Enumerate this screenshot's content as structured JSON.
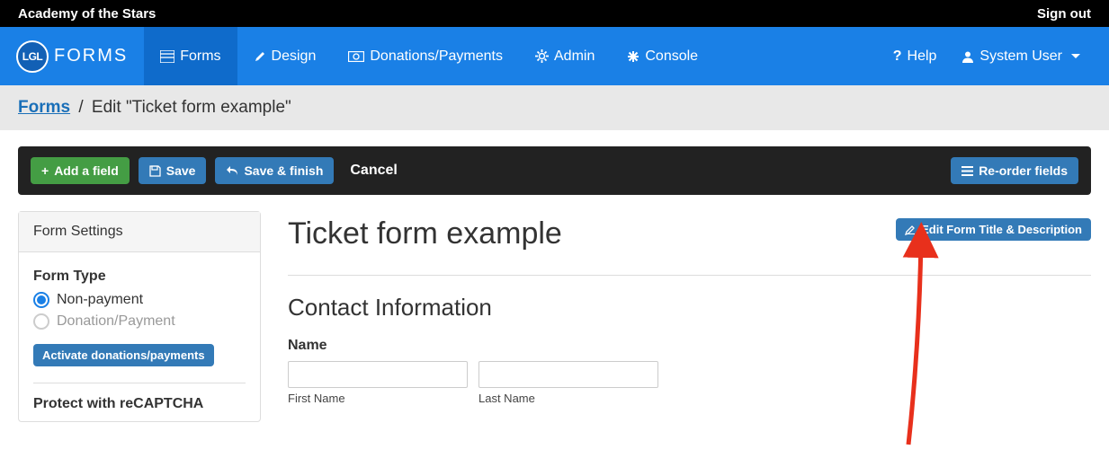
{
  "topbar": {
    "site_name": "Academy of the Stars",
    "signout": "Sign out"
  },
  "brand": {
    "logo_text": "LGL",
    "product": "FORMS"
  },
  "nav": {
    "forms": "Forms",
    "design": "Design",
    "donations": "Donations/Payments",
    "admin": "Admin",
    "console": "Console",
    "help": "Help",
    "user": "System User"
  },
  "breadcrumb": {
    "forms_link": "Forms",
    "current": "Edit \"Ticket form example\""
  },
  "toolbar": {
    "add_field": "Add a field",
    "save": "Save",
    "save_finish": "Save & finish",
    "cancel": "Cancel",
    "reorder": "Re-order fields"
  },
  "sidebar": {
    "header": "Form Settings",
    "form_type_label": "Form Type",
    "options": {
      "nonpayment": "Non-payment",
      "donation": "Donation/Payment"
    },
    "activate_btn": "Activate donations/payments",
    "protect_label": "Protect with reCAPTCHA"
  },
  "main": {
    "title": "Ticket form example",
    "edit_title_btn": "Edit Form Title & Description",
    "section_contact": "Contact Information",
    "name_label": "Name",
    "first_name_sub": "First Name",
    "last_name_sub": "Last Name"
  }
}
